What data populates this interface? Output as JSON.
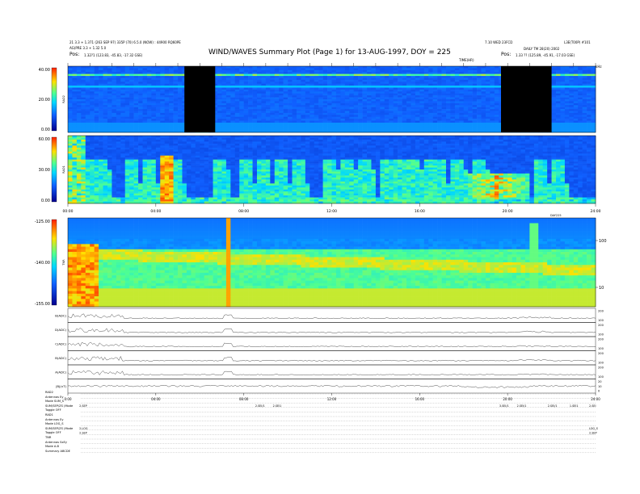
{
  "header": {
    "title": "WIND/WAVES Summary Plot (Page 1) for 13-AUG-1997, DOY = 225",
    "left_line1": "21 3.3 + 1.371 (263 SEP 97) 335P (70) 6.5.0 (NOW) : 44900 RQ60PE",
    "left_line2": "AG(PRE 3.3 + 1.32 5.0",
    "left_pos_label": "Pos:",
    "left_pos_value": "1.32?1 (123.83, -45.83, -17.32 GSE)",
    "right_line1": "7.10 WED 23FCD",
    "right_line1b": "L3E(T00P) #101",
    "right_line2": "DAILY TM 28(20) 2002",
    "right_pos_label": "Pos:",
    "right_pos_value": "1.33 ?? (125.89, -45.91, -17.03 GSE)",
    "top_tick_label": "TIME(HR)",
    "top_right_label": "kHz"
  },
  "chart_data": [
    {
      "type": "heatmap",
      "panel": "RAD2",
      "ylabel": "RAD2",
      "yticks": [
        "40.00",
        "20.00",
        "0.00"
      ],
      "ylim": [
        0,
        40
      ],
      "xlim": [
        0,
        24
      ],
      "data_gaps_hours": [
        [
          5.3,
          6.7
        ],
        [
          19.7,
          22.0
        ]
      ],
      "colorscale": "jet"
    },
    {
      "type": "heatmap",
      "panel": "RAD1",
      "ylabel": "RAD1",
      "yticks": [
        "60.00",
        "30.00",
        "0.00"
      ],
      "ylim": [
        0,
        60
      ],
      "xlim": [
        0,
        24
      ],
      "colorscale": "jet",
      "xticks": [
        "00:00",
        "04:00",
        "08:00",
        "12:00",
        "16:00",
        "20:00",
        "24:00"
      ],
      "x_right_label": "DAY225"
    },
    {
      "type": "heatmap",
      "panel": "TNR",
      "ylabel": "TNR",
      "yticks": [
        "-125.00",
        "-140.00",
        "-155.00"
      ],
      "ylim": [
        -155,
        -125
      ],
      "right_ticks": [
        "100",
        "10"
      ],
      "xlim": [
        0,
        24
      ],
      "colorscale": "jet"
    },
    {
      "type": "line",
      "panel": "fields",
      "series": [
        {
          "name": "B(ADC)",
          "right_ticks": [
            "200",
            "100"
          ]
        },
        {
          "name": "D(ADC)",
          "right_ticks": [
            "200",
            "100"
          ]
        },
        {
          "name": "C(ADC)",
          "right_ticks": [
            "200",
            "100"
          ]
        },
        {
          "name": "B(ADC)",
          "right_ticks": [
            "200",
            "100"
          ]
        },
        {
          "name": "A(ADC)",
          "right_ticks": [
            "200",
            "100"
          ]
        },
        {
          "name": "|B|(nT)",
          "right_ticks": [
            "20",
            "10",
            "0"
          ]
        }
      ],
      "xticks": [
        "0:00",
        "04:00",
        "08:00",
        "12:00",
        "16:00",
        "20:00",
        "24:00"
      ],
      "xlim": [
        0,
        24
      ]
    }
  ],
  "footer": {
    "lines": [
      "RAD2",
      "Antennas Ey",
      "Mode  SUM_S",
      "SUM/SEP/ZS (Mode",
      "Toggle OFF",
      "RAD1",
      "Antennas Ey",
      "Mode  LOG_S",
      "SUM/SEP/ZS (Mode",
      "Toggle OFF",
      "TNR",
      "Antennas SxEy",
      "Mode  A-B",
      "Summary ABCDE"
    ],
    "markers": [
      {
        "row": 3,
        "hour": 0.3,
        "text": "2.SEP"
      },
      {
        "row": 3,
        "hour": 8.3,
        "text": "2.SEI/1"
      },
      {
        "row": 3,
        "hour": 9.1,
        "text": "2.SEI1"
      },
      {
        "row": 3,
        "hour": 19.4,
        "text": "3.SEI/1"
      },
      {
        "row": 3,
        "hour": 20.2,
        "text": "2.SEI/1"
      },
      {
        "row": 3,
        "hour": 21.6,
        "text": "2.SEI/1"
      },
      {
        "row": 3,
        "hour": 22.6,
        "text": "1.SEI1"
      },
      {
        "row": 3,
        "hour": 24.0,
        "text": "2.SEI"
      },
      {
        "row": 8,
        "hour": 0.3,
        "text": "2.LOG"
      },
      {
        "row": 8,
        "hour": 24.0,
        "text": "LOG_S"
      },
      {
        "row": 9,
        "hour": 0.3,
        "text": "2.SEP"
      },
      {
        "row": 9,
        "hour": 24.0,
        "text": "2.SEP"
      }
    ]
  },
  "colors": {
    "jet_low": "#00008f",
    "jet_blue": "#1060ff",
    "jet_cyan": "#00d8ff",
    "jet_green": "#50ff90",
    "jet_yellow": "#ffe000",
    "jet_red": "#ff2000",
    "gap": "#000000"
  }
}
